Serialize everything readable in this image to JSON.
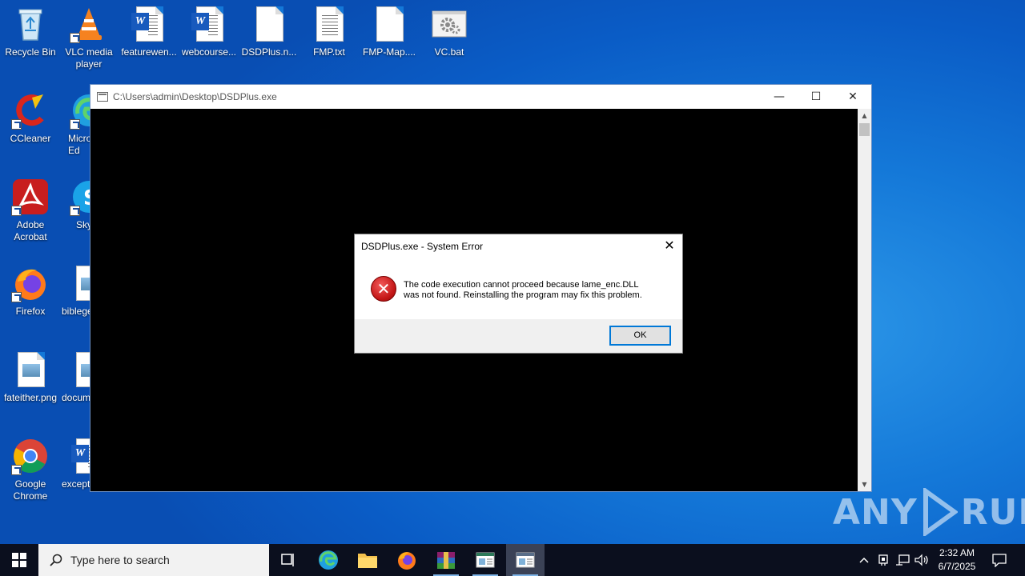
{
  "desktop": {
    "icons": [
      {
        "label": "Recycle Bin"
      },
      {
        "label": "VLC media player"
      },
      {
        "label": "featurewen..."
      },
      {
        "label": "webcourse..."
      },
      {
        "label": "DSDPlus.n..."
      },
      {
        "label": "FMP.txt"
      },
      {
        "label": "FMP-Map...."
      },
      {
        "label": "VC.bat"
      },
      {
        "label": "CCleaner"
      },
      {
        "label": "Micro Ed"
      },
      {
        "label": "Adobe Acrobat"
      },
      {
        "label": "Sky"
      },
      {
        "label": "Firefox"
      },
      {
        "label": "biblege"
      },
      {
        "label": "fateither.png"
      },
      {
        "label": "docum"
      },
      {
        "label": "Google Chrome"
      },
      {
        "label": "except"
      }
    ]
  },
  "console_window": {
    "title": "C:\\Users\\admin\\Desktop\\DSDPlus.exe",
    "minimize": "—",
    "maximize": "☐",
    "close": "✕"
  },
  "dialog": {
    "title": "DSDPlus.exe - System Error",
    "close": "✕",
    "message_line1": "The code execution cannot proceed because lame_enc.DLL",
    "message_line2": "was not found. Reinstalling the program may fix this problem.",
    "ok_label": "OK",
    "icon": "error-icon"
  },
  "watermark": {
    "left": "ANY",
    "right": "RUN"
  },
  "taskbar": {
    "search_placeholder": "Type here to search",
    "clock_time": "2:32 AM",
    "clock_date": "6/7/2025"
  },
  "colors": {
    "desktop_blue": "#1478d8",
    "taskbar": "#0b0f1e",
    "error_red": "#c31616",
    "focus_blue": "#0078d7"
  }
}
